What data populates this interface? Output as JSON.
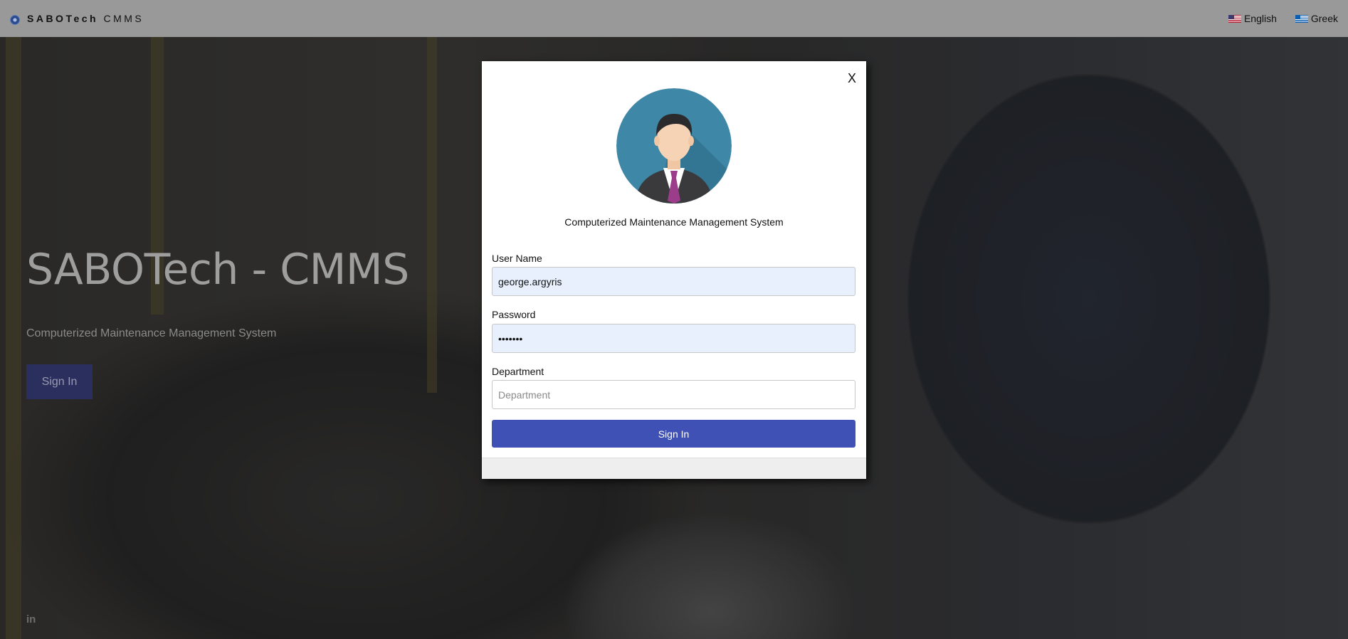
{
  "topbar": {
    "brand_bold": "SABOTech",
    "brand_rest": "CMMS",
    "languages": [
      {
        "label": "English",
        "icon": "us-flag-icon"
      },
      {
        "label": "Greek",
        "icon": "greece-flag-icon"
      }
    ]
  },
  "hero": {
    "title": "SABOTech - CMMS",
    "subtitle": "Computerized Maintenance Management System",
    "signin_label": "Sign In",
    "social_icon": "in"
  },
  "modal": {
    "close_label": "X",
    "subtitle": "Computerized Maintenance Management System",
    "username": {
      "label": "User Name",
      "value": "george.argyris"
    },
    "password": {
      "label": "Password",
      "value": "•••••••"
    },
    "department": {
      "label": "Department",
      "placeholder": "Department",
      "value": ""
    },
    "signin_label": "Sign In"
  },
  "colors": {
    "topbar": "#999999",
    "primary_button": "#3f51b5",
    "autofill_bg": "#e8f0fe"
  }
}
